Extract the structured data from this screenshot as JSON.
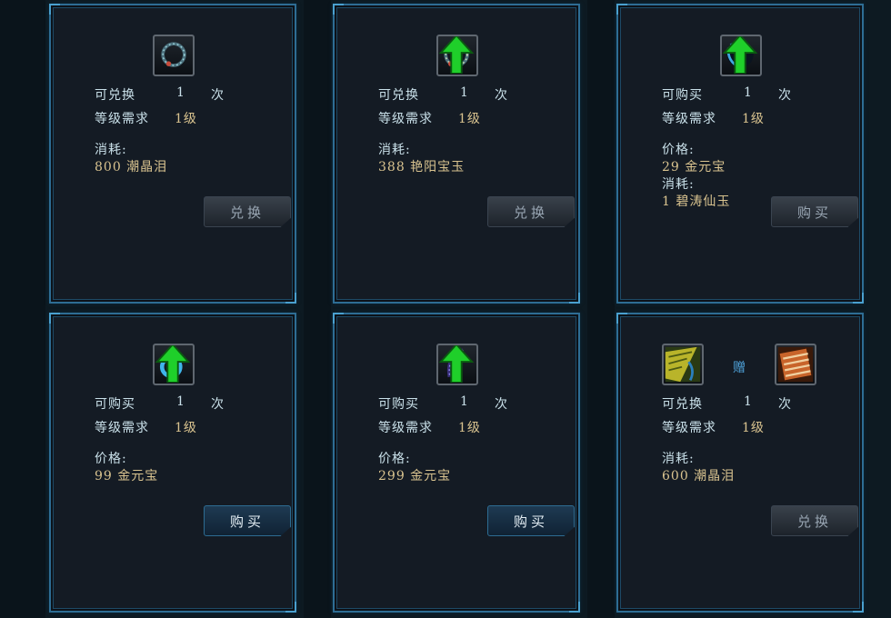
{
  "labels": {
    "exchange_count": "可兑换",
    "purchase_count": "可购买",
    "level_req": "等级需求",
    "cost": "消耗:",
    "price": "价格:",
    "times_unit": "次",
    "gift": "赠"
  },
  "cards": [
    {
      "icon": "blue-bead-necklace-icon",
      "count_label": "可兑换",
      "count": "1",
      "unit": "次",
      "level_label": "等级需求",
      "level": "1级",
      "cost_label": "消耗:",
      "cost": "800 潮晶泪",
      "button": "兑换"
    },
    {
      "icon": "bead-necklace-upgrade-icon",
      "count_label": "可兑换",
      "count": "1",
      "unit": "次",
      "level_label": "等级需求",
      "level": "1级",
      "cost_label": "消耗:",
      "cost": "388 艳阳宝玉",
      "button": "兑换"
    },
    {
      "icon": "dark-orb-upgrade-icon",
      "count_label": "可购买",
      "count": "1",
      "unit": "次",
      "level_label": "等级需求",
      "level": "1级",
      "price_label": "价格:",
      "price": "29 金元宝",
      "cost_label": "消耗:",
      "cost": "1 碧涛仙玉",
      "button": "购买"
    },
    {
      "icon": "blue-bracelet-upgrade-icon",
      "count_label": "可购买",
      "count": "1",
      "unit": "次",
      "level_label": "等级需求",
      "level": "1级",
      "price_label": "价格:",
      "price": "99 金元宝",
      "button": "购买"
    },
    {
      "icon": "purple-pendant-upgrade-icon",
      "count_label": "可购买",
      "count": "1",
      "unit": "次",
      "level_label": "等级需求",
      "level": "1级",
      "price_label": "价格:",
      "price": "299 金元宝",
      "button": "购买"
    },
    {
      "icon": "yellow-scroll-icon",
      "gift_icon": "striped-scroll-icon",
      "gift_label": "赠",
      "count_label": "可兑换",
      "count": "1",
      "unit": "次",
      "level_label": "等级需求",
      "level": "1级",
      "cost_label": "消耗:",
      "cost": "600 潮晶泪",
      "button": "兑换"
    }
  ],
  "colors": {
    "label_text": "#c9e0e9",
    "value_text": "#d9c38f",
    "card_border": "#2e6d94",
    "upgrade_arrow": "#1fcf2a"
  }
}
